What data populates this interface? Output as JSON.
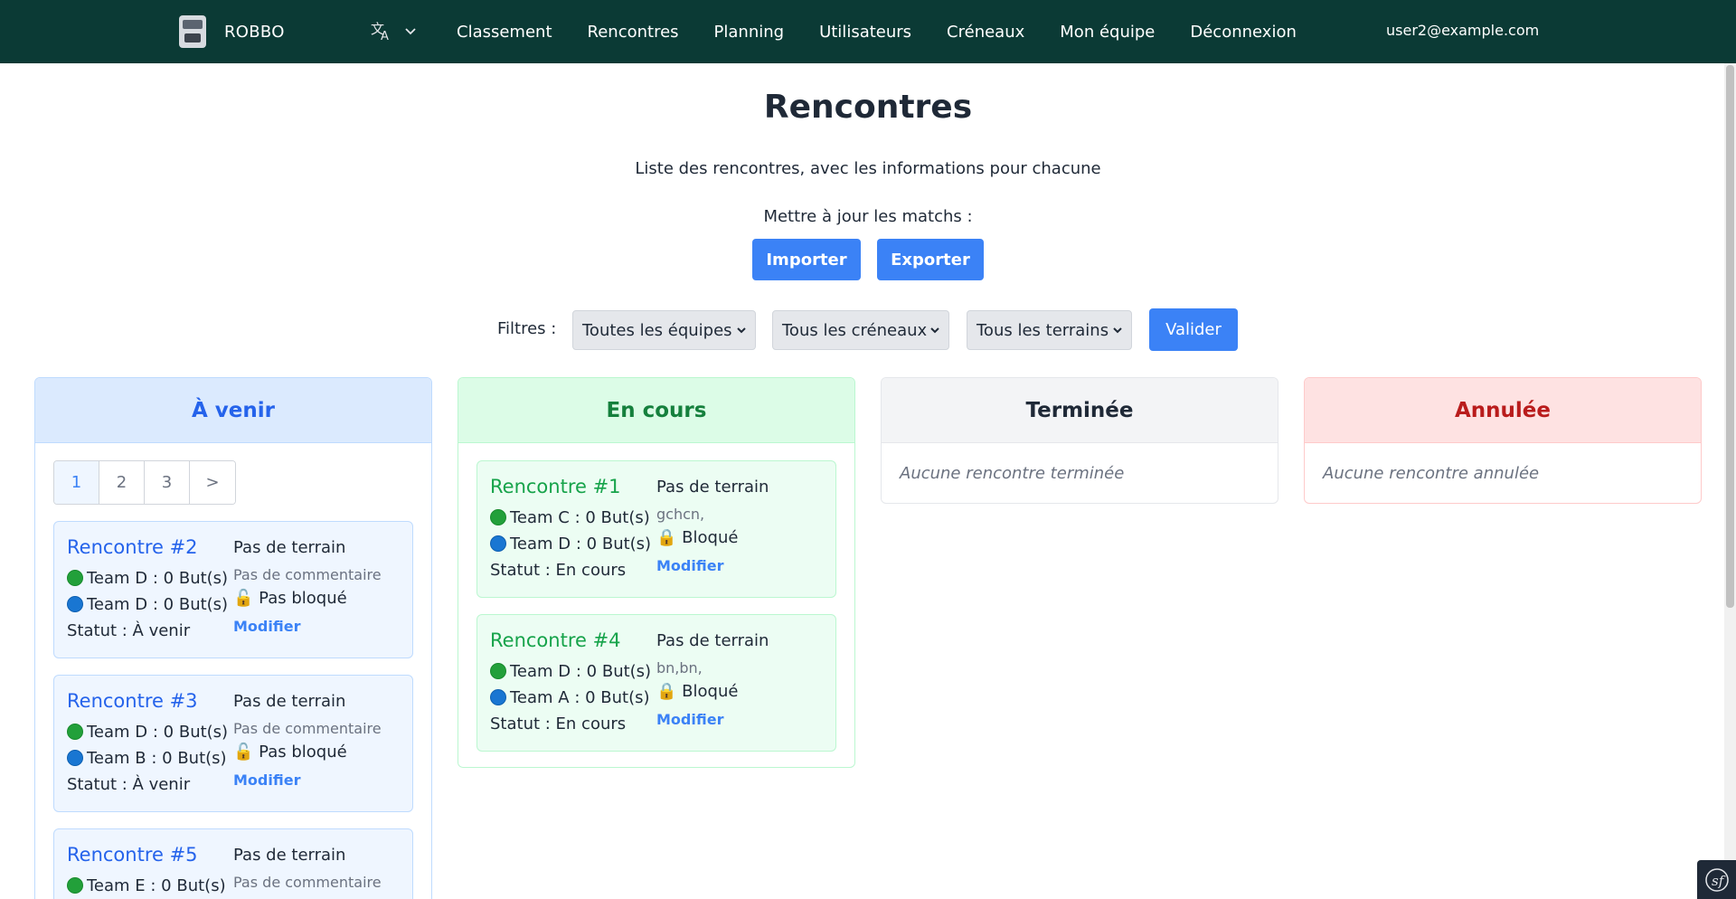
{
  "nav": {
    "brand": "ROBBO",
    "links": [
      "Classement",
      "Rencontres",
      "Planning",
      "Utilisateurs",
      "Créneaux",
      "Mon équipe",
      "Déconnexion"
    ],
    "user_email": "user2@example.com",
    "language_icon": "translate-icon"
  },
  "header": {
    "title": "Rencontres",
    "subtitle": "Liste des rencontres, avec les informations pour chacune",
    "update_label": "Mettre à jour les matchs :",
    "import_label": "Importer",
    "export_label": "Exporter"
  },
  "filters": {
    "label": "Filtres :",
    "teams": "Toutes les équipes",
    "slots": "Tous les créneaux",
    "fields": "Tous les terrains",
    "submit": "Valider"
  },
  "columns": {
    "avenir": {
      "title": "À venir",
      "color": "#2563eb",
      "pager": [
        "1",
        "2",
        "3",
        ">"
      ],
      "cards": [
        {
          "title": "Rencontre #2",
          "team1": "Team D : 0 But(s)",
          "team2": "Team D : 0 But(s)",
          "status": "Statut : À venir",
          "terrain": "Pas de terrain",
          "comment": "Pas de commentaire",
          "lock_icon": "🔓",
          "lock": "Pas bloqué",
          "edit": "Modifier"
        },
        {
          "title": "Rencontre #3",
          "team1": "Team D : 0 But(s)",
          "team2": "Team B : 0 But(s)",
          "status": "Statut : À venir",
          "terrain": "Pas de terrain",
          "comment": "Pas de commentaire",
          "lock_icon": "🔓",
          "lock": "Pas bloqué",
          "edit": "Modifier"
        },
        {
          "title": "Rencontre #5",
          "team1": "Team E : 0 But(s)",
          "terrain": "Pas de terrain",
          "comment": "Pas de commentaire"
        }
      ]
    },
    "encours": {
      "title": "En cours",
      "color": "#15803d",
      "cards": [
        {
          "title": "Rencontre #1",
          "team1": "Team C : 0 But(s)",
          "team2": "Team D : 0 But(s)",
          "status": "Statut : En cours",
          "terrain": "Pas de terrain",
          "comment": "gchcn,",
          "lock_icon": "🔒",
          "lock": "Bloqué",
          "edit": "Modifier"
        },
        {
          "title": "Rencontre #4",
          "team1": "Team D : 0 But(s)",
          "team2": "Team A : 0 But(s)",
          "status": "Statut : En cours",
          "terrain": "Pas de terrain",
          "comment": "bn,bn,",
          "lock_icon": "🔒",
          "lock": "Bloqué",
          "edit": "Modifier"
        }
      ]
    },
    "terminee": {
      "title": "Terminée",
      "color": "#1f2937",
      "empty": "Aucune rencontre terminée"
    },
    "annulee": {
      "title": "Annulée",
      "color": "#b91c1c",
      "empty": "Aucune rencontre annulée"
    }
  }
}
